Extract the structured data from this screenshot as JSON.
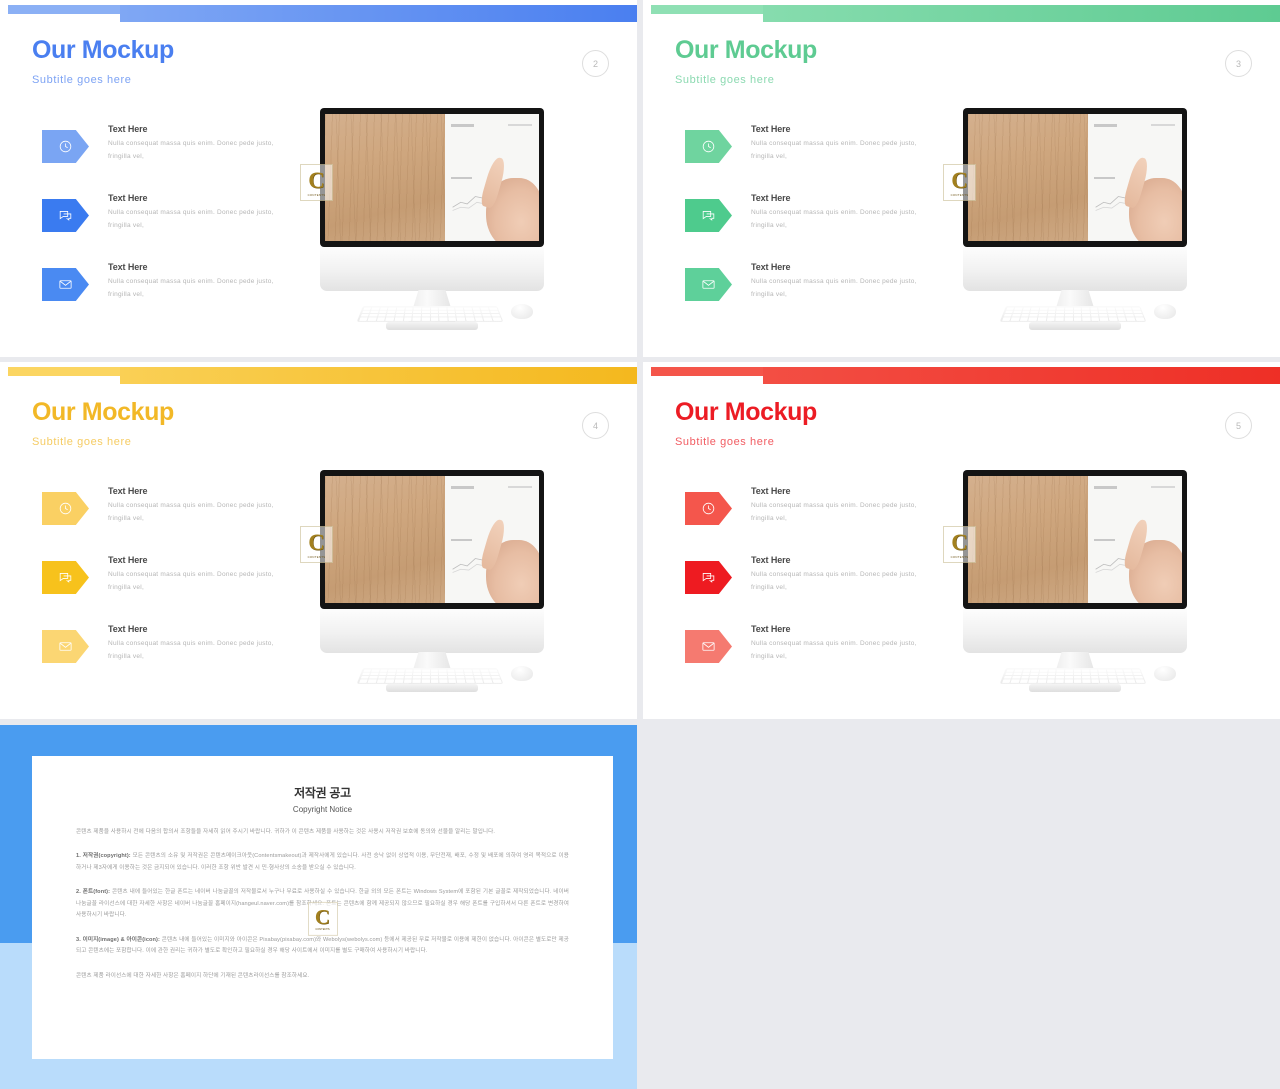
{
  "slides": [
    {
      "id": "slide-blue",
      "page": "2",
      "title": "Our Mockup",
      "subtitle": "Subtitle goes here",
      "accent": "#4a7ff0",
      "bar_light": "#8bb0f5",
      "bar_dark": "#4a7ff0",
      "bullets": [
        {
          "icon": "clock-icon",
          "title": "Text Here",
          "desc": "Nulla consequat massa quis enim. Donec pede justo, fringilla vel,",
          "color": "#7aa5f3"
        },
        {
          "icon": "chat-icon",
          "title": "Text Here",
          "desc": "Nulla consequat massa quis enim. Donec pede justo, fringilla vel,",
          "color": "#3a7bf0"
        },
        {
          "icon": "mail-icon",
          "title": "Text Here",
          "desc": "Nulla consequat massa quis enim. Donec pede justo, fringilla vel,",
          "color": "#4a8af2"
        }
      ]
    },
    {
      "id": "slide-green",
      "page": "3",
      "title": "Our Mockup",
      "subtitle": "Subtitle goes here",
      "accent": "#5ecb92",
      "bar_light": "#8fe0b4",
      "bar_dark": "#5ecb92",
      "bullets": [
        {
          "icon": "clock-icon",
          "title": "Text Here",
          "desc": "Nulla consequat massa quis enim. Donec pede justo, fringilla vel,",
          "color": "#6fd49f"
        },
        {
          "icon": "chat-icon",
          "title": "Text Here",
          "desc": "Nulla consequat massa quis enim. Donec pede justo, fringilla vel,",
          "color": "#4ecb8d"
        },
        {
          "icon": "mail-icon",
          "title": "Text Here",
          "desc": "Nulla consequat massa quis enim. Donec pede justo, fringilla vel,",
          "color": "#5ed09a"
        }
      ]
    },
    {
      "id": "slide-yellow",
      "page": "4",
      "title": "Our Mockup",
      "subtitle": "Subtitle goes here",
      "accent": "#f2b827",
      "bar_light": "#fbd561",
      "bar_dark": "#f4b81e",
      "bullets": [
        {
          "icon": "clock-icon",
          "title": "Text Here",
          "desc": "Nulla consequat massa quis enim. Donec pede justo, fringilla vel,",
          "color": "#fad063"
        },
        {
          "icon": "chat-icon",
          "title": "Text Here",
          "desc": "Nulla consequat massa quis enim. Donec pede justo, fringilla vel,",
          "color": "#f7c21c"
        },
        {
          "icon": "mail-icon",
          "title": "Text Here",
          "desc": "Nulla consequat massa quis enim. Donec pede justo, fringilla vel,",
          "color": "#fbd673"
        }
      ]
    },
    {
      "id": "slide-red",
      "page": "5",
      "title": "Our Mockup",
      "subtitle": "Subtitle goes here",
      "accent": "#ec1c24",
      "bar_light": "#f4554a",
      "bar_dark": "#ee2f26",
      "bullets": [
        {
          "icon": "clock-icon",
          "title": "Text Here",
          "desc": "Nulla consequat massa quis enim. Donec pede justo, fringilla vel,",
          "color": "#f4564c"
        },
        {
          "icon": "chat-icon",
          "title": "Text Here",
          "desc": "Nulla consequat massa quis enim. Donec pede justo, fringilla vel,",
          "color": "#ee1b21"
        },
        {
          "icon": "mail-icon",
          "title": "Text Here",
          "desc": "Nulla consequat massa quis enim. Donec pede justo, fringilla vel,",
          "color": "#f57a70"
        }
      ]
    }
  ],
  "watermark": {
    "letter": "C",
    "caption": "CONTENTS"
  },
  "copyright": {
    "frame_top_color": "#4a9cf0",
    "frame_bottom_color": "#b9dcfb",
    "title_ko": "저작권 공고",
    "title_en": "Copyright Notice",
    "intro": "콘텐츠 제품을 사용하시 전에 다음의 합의서 조항들을 자세히 읽어 주시기 바랍니다. 귀하가 이 콘텐츠 제품을 사용하는 것은 사용시 저작권 보호에 동의와 선물을 알리는 말입니다.",
    "item1_label": "1. 저작권(copyright):",
    "item1": " 모든 콘텐츠의 소유 및 저작권은 콘텐츠메이크아웃(Contentsmakeout)과 제작사에게 있습니다. 사전 승낙 없이 상업적 이용, 무단전재, 배포, 수정 및 배포에 의하여 영리 목적으로 이용하거나 제3자에게 이용하는 것은 금지되어 있습니다. 이러한 조항 위반 발견 시 민·형사상의 소송을 받으실 수 있습니다.",
    "item2_label": "2. 폰트(font):",
    "item2": " 콘텐츠 내에 들어있는 한글 폰트는 네이버 나눔글꼴의 저작물로서 누구나 무료로 사용하실 수 있습니다. 한글 외의 모든 폰트는 Windows System에 포함된 기본 글꼴로 제작되었습니다. 네이버 나눔글꼴 라이선스에 대한 자세한 사항은 네이버 나눔글꼴 홈페이지(hangeul.naver.com)를 참조하세요. 폰트는 콘텐츠에 함께 제공되지 않으므로 필요하실 경우 해당 폰트를 구입하셔서 다른 폰트로 변경하여 사용하시기 바랍니다.",
    "item3_label": "3. 이미지(image) & 아이콘(icon):",
    "item3": " 콘텐츠 내에 들어있는 이미지와 아이콘은 Pixabay(pixabay.com)와 Webolys(webolys.com) 등에서 제공된 무료 저작물로 이용에 제한이 없습니다. 아이콘은 별도로만 제공되고 콘텐츠에는 포함합니다. 이에 관한 권리는 귀하가 별도로 확인하고 필요하실 경우 해당 사이트에서 이미지를 별도 구매하여 사용하시기 바랍니다.",
    "footer": "콘텐츠 제품 라이선스에 대한 자세한 사항은 홈페이지 하단에 기재된 콘텐츠라이선스를 참조하세요."
  }
}
